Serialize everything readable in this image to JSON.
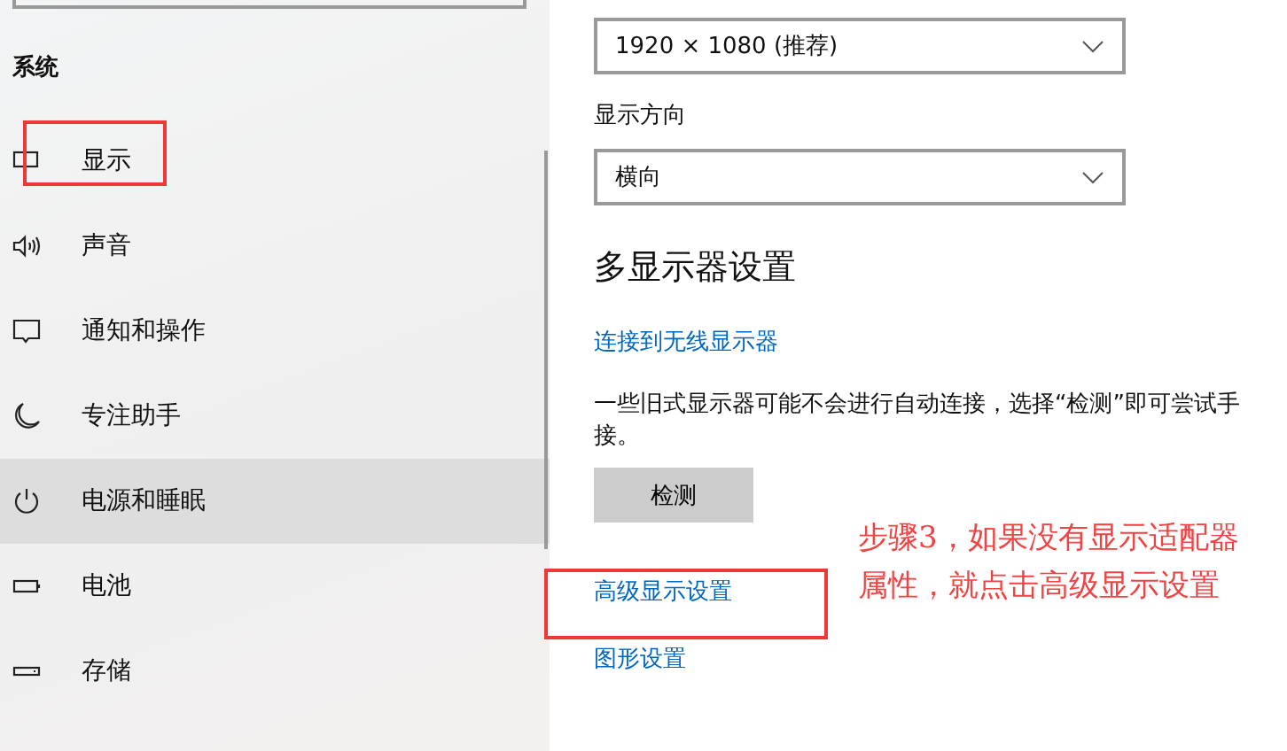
{
  "sidebar": {
    "heading": "系统",
    "items": [
      {
        "label": "显示",
        "hovered": false
      },
      {
        "label": "声音",
        "hovered": false
      },
      {
        "label": "通知和操作",
        "hovered": false
      },
      {
        "label": "专注助手",
        "hovered": false
      },
      {
        "label": "电源和睡眠",
        "hovered": true
      },
      {
        "label": "电池",
        "hovered": false
      },
      {
        "label": "存储",
        "hovered": false
      }
    ]
  },
  "main": {
    "resolution": {
      "value": "1920 × 1080 (推荐)"
    },
    "orientation": {
      "label": "显示方向",
      "value": "横向"
    },
    "multi_display": {
      "title": "多显示器设置",
      "wireless_link": "连接到无线显示器",
      "note_lines": [
        "一些旧式显示器可能不会进行自动连接，选择“检测”即可尝试手",
        "接。"
      ],
      "detect_button": "检测",
      "advanced_link": "高级显示设置",
      "graphics_link": "图形设置"
    }
  },
  "annotation": {
    "lines": [
      "步骤3，如果没有显示适配器",
      "属性，就点击高级显示设置"
    ]
  }
}
